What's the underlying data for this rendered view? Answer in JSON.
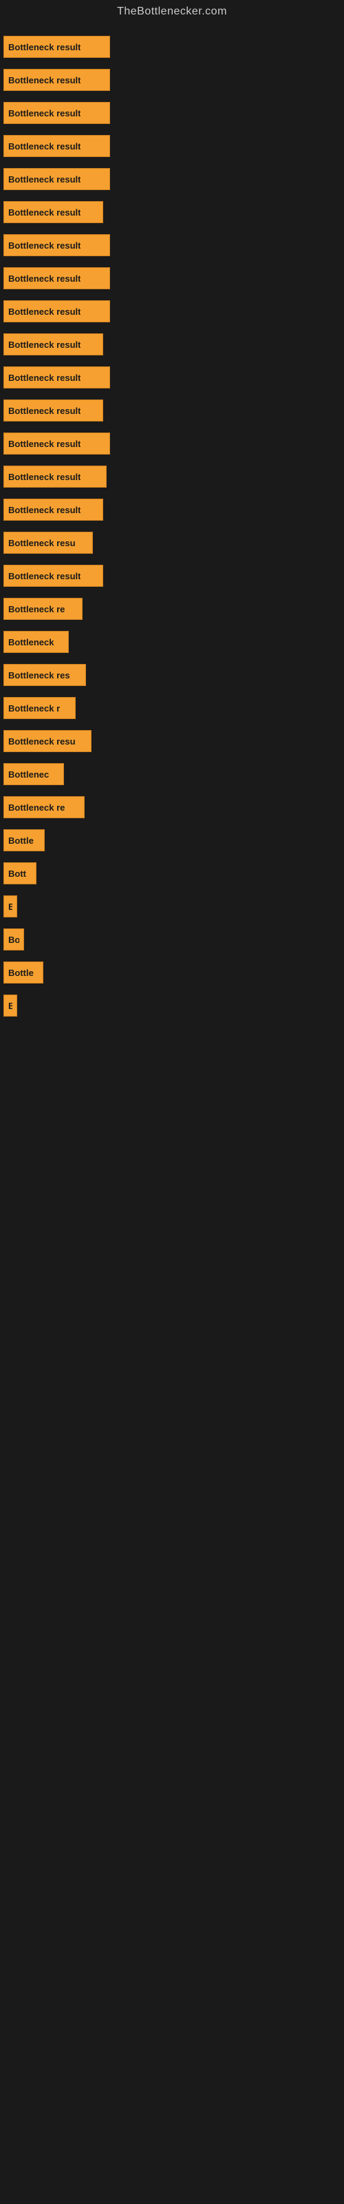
{
  "site": {
    "title": "TheBottlenecker.com"
  },
  "bars": [
    {
      "label": "Bottleneck result",
      "width": 155
    },
    {
      "label": "Bottleneck result",
      "width": 155
    },
    {
      "label": "Bottleneck result",
      "width": 155
    },
    {
      "label": "Bottleneck result",
      "width": 155
    },
    {
      "label": "Bottleneck result",
      "width": 155
    },
    {
      "label": "Bottleneck result",
      "width": 145
    },
    {
      "label": "Bottleneck result",
      "width": 155
    },
    {
      "label": "Bottleneck result",
      "width": 155
    },
    {
      "label": "Bottleneck result",
      "width": 155
    },
    {
      "label": "Bottleneck result",
      "width": 145
    },
    {
      "label": "Bottleneck result",
      "width": 155
    },
    {
      "label": "Bottleneck result",
      "width": 145
    },
    {
      "label": "Bottleneck result",
      "width": 155
    },
    {
      "label": "Bottleneck result",
      "width": 150
    },
    {
      "label": "Bottleneck result",
      "width": 145
    },
    {
      "label": "Bottleneck resu",
      "width": 130
    },
    {
      "label": "Bottleneck result",
      "width": 145
    },
    {
      "label": "Bottleneck re",
      "width": 115
    },
    {
      "label": "Bottleneck",
      "width": 95
    },
    {
      "label": "Bottleneck res",
      "width": 120
    },
    {
      "label": "Bottleneck r",
      "width": 105
    },
    {
      "label": "Bottleneck resu",
      "width": 128
    },
    {
      "label": "Bottlenec",
      "width": 88
    },
    {
      "label": "Bottleneck re",
      "width": 118
    },
    {
      "label": "Bottle",
      "width": 60
    },
    {
      "label": "Bott",
      "width": 48
    },
    {
      "label": "B",
      "width": 18
    },
    {
      "label": "Bo",
      "width": 30
    },
    {
      "label": "Bottle",
      "width": 58
    },
    {
      "label": "B",
      "width": 14
    }
  ]
}
